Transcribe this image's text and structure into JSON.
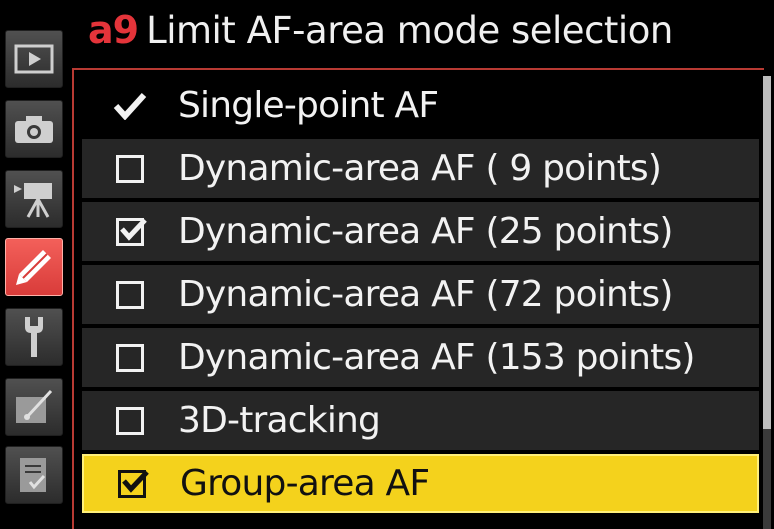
{
  "header": {
    "code": "a9",
    "title": "Limit AF-area mode selection"
  },
  "sidebar": {
    "tabs": [
      {
        "icon": "playback-icon",
        "active": false
      },
      {
        "icon": "camera-icon",
        "active": false
      },
      {
        "icon": "movie-camera-icon",
        "active": false
      },
      {
        "icon": "pencil-icon",
        "active": true
      },
      {
        "icon": "wrench-icon",
        "active": false
      },
      {
        "icon": "retouch-icon",
        "active": false
      },
      {
        "icon": "my-menu-icon",
        "active": false
      }
    ]
  },
  "list": {
    "items": [
      {
        "label": "Single-point AF",
        "state": "checkmark"
      },
      {
        "label": "Dynamic-area AF ( 9 points)",
        "state": "unchecked"
      },
      {
        "label": "Dynamic-area AF (25 points)",
        "state": "checked"
      },
      {
        "label": "Dynamic-area AF (72 points)",
        "state": "unchecked"
      },
      {
        "label": "Dynamic-area AF (153 points)",
        "state": "unchecked"
      },
      {
        "label": "3D-tracking",
        "state": "unchecked"
      },
      {
        "label": "Group-area AF",
        "state": "checked",
        "selected": true
      }
    ]
  },
  "scrollbar": {
    "visible_fraction": 0.78
  },
  "colors": {
    "accent_red": "#e4343a",
    "highlight_yellow": "#f4d21c",
    "row_bg": "#262626"
  }
}
